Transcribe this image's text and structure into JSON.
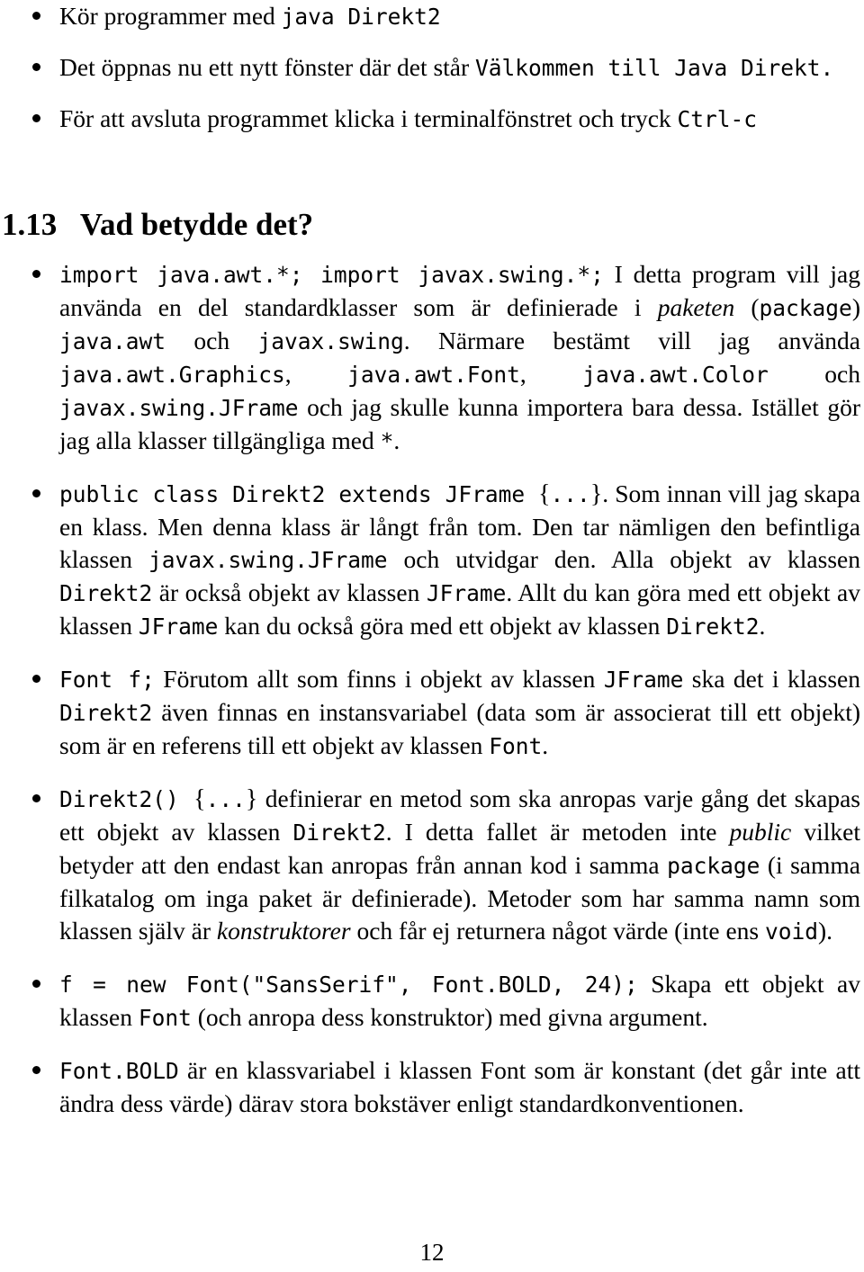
{
  "document": {
    "page_number": "12",
    "section": {
      "number": "1.13",
      "title": "Vad betydde det?"
    }
  },
  "top_bullets": [
    {
      "id": "run-program",
      "parts": [
        {
          "style": "roman",
          "text": "Kör programmer med "
        },
        {
          "style": "mono",
          "text": "java Direkt2"
        }
      ],
      "plain": "Kör programmer med java Direkt2"
    },
    {
      "id": "new-window",
      "parts": [
        {
          "style": "roman",
          "text": "Det öppnas nu ett nytt fönster där det står "
        },
        {
          "style": "mono",
          "text": "Välkommen till Java Direkt."
        }
      ],
      "plain": "Det öppnas nu ett nytt fönster där det står Välkommen till Java Direkt."
    },
    {
      "id": "quit-program",
      "parts": [
        {
          "style": "roman",
          "text": "För att avsluta programmet klicka i terminalfönstret och tryck "
        },
        {
          "style": "mono",
          "text": "Ctrl-c"
        }
      ],
      "plain": "För att avsluta programmet klicka i terminalfönstret och tryck Ctrl-c"
    }
  ],
  "body_bullets": [
    {
      "id": "imports",
      "parts": [
        {
          "style": "mono",
          "text": "import java.awt.*; import javax.swing.*;"
        },
        {
          "style": "roman",
          "text": " I detta program vill jag använda en del standardklasser som är definierade i "
        },
        {
          "style": "italic",
          "text": "paketen"
        },
        {
          "style": "roman",
          "text": " ("
        },
        {
          "style": "mono",
          "text": "package"
        },
        {
          "style": "roman",
          "text": ") "
        },
        {
          "style": "mono",
          "text": "java.awt"
        },
        {
          "style": "roman",
          "text": " och "
        },
        {
          "style": "mono",
          "text": "javax.swing"
        },
        {
          "style": "roman",
          "text": ". Närmare bestämt vill jag använda "
        },
        {
          "style": "mono",
          "text": "java.awt.Graphics"
        },
        {
          "style": "roman",
          "text": ", "
        },
        {
          "style": "mono",
          "text": "java.awt.Font"
        },
        {
          "style": "roman",
          "text": ", "
        },
        {
          "style": "mono",
          "text": "java.awt.Color"
        },
        {
          "style": "roman",
          "text": " och "
        },
        {
          "style": "mono",
          "text": "javax.swing.JFrame"
        },
        {
          "style": "roman",
          "text": " och jag skulle kunna importera bara dessa. Istället gör jag alla klasser tillgängliga med "
        },
        {
          "style": "mono",
          "text": "*"
        },
        {
          "style": "roman",
          "text": "."
        }
      ],
      "plain": "import java.awt.*; import javax.swing.*; I detta program vill jag använda en del standardklasser som är definierade i paketen (package) java.awt och javax.swing. Närmare bestämt vill jag använda java.awt.Graphics, java.awt.Font, java.awt.Color och javax.swing.JFrame och jag skulle kunna importera bara dessa. Istället gör jag alla klasser tillgängliga med *."
    },
    {
      "id": "class-declaration",
      "parts": [
        {
          "style": "mono",
          "text": "public class Direkt2 extends JFrame "
        },
        {
          "style": "brace",
          "text": "{"
        },
        {
          "style": "mono",
          "text": "..."
        },
        {
          "style": "brace",
          "text": "}"
        },
        {
          "style": "roman",
          "text": ". Som innan vill jag skapa en klass. Men denna klass är långt från tom. Den tar nämligen den befintliga klassen "
        },
        {
          "style": "mono",
          "text": "javax.swing.JFrame"
        },
        {
          "style": "roman",
          "text": " och utvidgar den. Alla objekt av klassen "
        },
        {
          "style": "mono",
          "text": "Direkt2"
        },
        {
          "style": "roman",
          "text": " är också objekt av klassen "
        },
        {
          "style": "mono",
          "text": "JFrame"
        },
        {
          "style": "roman",
          "text": ". Allt du kan göra med ett objekt av klassen "
        },
        {
          "style": "mono",
          "text": "JFrame"
        },
        {
          "style": "roman",
          "text": " kan du också göra med ett objekt av klassen "
        },
        {
          "style": "mono",
          "text": "Direkt2"
        },
        {
          "style": "roman",
          "text": "."
        }
      ],
      "plain": "public class Direkt2 extends JFrame {...}. Som innan vill jag skapa en klass. Men denna klass är långt från tom. Den tar nämligen den befintliga klassen javax.swing.JFrame och utvidgar den. Alla objekt av klassen Direkt2 är också objekt av klassen JFrame. Allt du kan göra med ett objekt av klassen JFrame kan du också göra med ett objekt av klassen Direkt2."
    },
    {
      "id": "font-field",
      "parts": [
        {
          "style": "mono",
          "text": "Font f;"
        },
        {
          "style": "roman",
          "text": " Förutom allt som finns i objekt av klassen "
        },
        {
          "style": "mono",
          "text": "JFrame"
        },
        {
          "style": "roman",
          "text": " ska det i klassen "
        },
        {
          "style": "mono",
          "text": "Direkt2"
        },
        {
          "style": "roman",
          "text": " även finnas en instansvariabel (data som är associerat till ett objekt) som är en referens till ett objekt av klassen "
        },
        {
          "style": "mono",
          "text": "Font"
        },
        {
          "style": "roman",
          "text": "."
        }
      ],
      "plain": "Font f; Förutom allt som finns i objekt av klassen JFrame ska det i klassen Direkt2 även finnas en instansvariabel (data som är associerat till ett objekt) som är en referens till ett objekt av klassen Font."
    },
    {
      "id": "constructor",
      "parts": [
        {
          "style": "mono",
          "text": "Direkt2() "
        },
        {
          "style": "brace",
          "text": "{"
        },
        {
          "style": "mono",
          "text": "..."
        },
        {
          "style": "brace",
          "text": "}"
        },
        {
          "style": "roman",
          "text": " definierar en metod som ska anropas varje gång det skapas ett objekt av klassen "
        },
        {
          "style": "mono",
          "text": "Direkt2"
        },
        {
          "style": "roman",
          "text": ". I detta fallet är metoden inte "
        },
        {
          "style": "italic",
          "text": "public"
        },
        {
          "style": "roman",
          "text": " vilket betyder att den endast kan anropas från annan kod i samma "
        },
        {
          "style": "mono",
          "text": "package"
        },
        {
          "style": "roman",
          "text": " (i samma filkatalog om inga paket är definierade). Metoder som har samma namn som klassen själv är "
        },
        {
          "style": "italic",
          "text": "konstruktorer"
        },
        {
          "style": "roman",
          "text": " och får ej returnera något värde (inte ens "
        },
        {
          "style": "mono",
          "text": "void"
        },
        {
          "style": "roman",
          "text": ")."
        }
      ],
      "plain": "Direkt2() {...} definierar en metod som ska anropas varje gång det skapas ett objekt av klassen Direkt2. I detta fallet är metoden inte public vilket betyder att den endast kan anropas från annan kod i samma package (i samma filkatalog om inga paket är definierade). Metoder som har samma namn som klassen själv är konstruktorer och får ej returnera något värde (inte ens void)."
    },
    {
      "id": "font-assignment",
      "parts": [
        {
          "style": "mono",
          "text": "f = new Font(\"SansSerif\", Font.BOLD, 24);"
        },
        {
          "style": "roman",
          "text": " Skapa ett objekt av klassen "
        },
        {
          "style": "mono",
          "text": "Font"
        },
        {
          "style": "roman",
          "text": " (och anropa dess konstruktor) med givna argument."
        }
      ],
      "plain": "f = new Font(\"SansSerif\", Font.BOLD, 24); Skapa ett objekt av klassen Font (och anropa dess konstruktor) med givna argument."
    },
    {
      "id": "font-bold-constant",
      "parts": [
        {
          "style": "mono",
          "text": "Font.BOLD"
        },
        {
          "style": "roman",
          "text": " är en klassvariabel i klassen Font som är konstant (det går inte att ändra dess värde) därav stora bokstäver enligt standardkonventionen."
        }
      ],
      "plain": "Font.BOLD är en klassvariabel i klassen Font som är konstant (det går inte att ändra dess värde) därav stora bokstäver enligt standardkonventionen."
    }
  ]
}
